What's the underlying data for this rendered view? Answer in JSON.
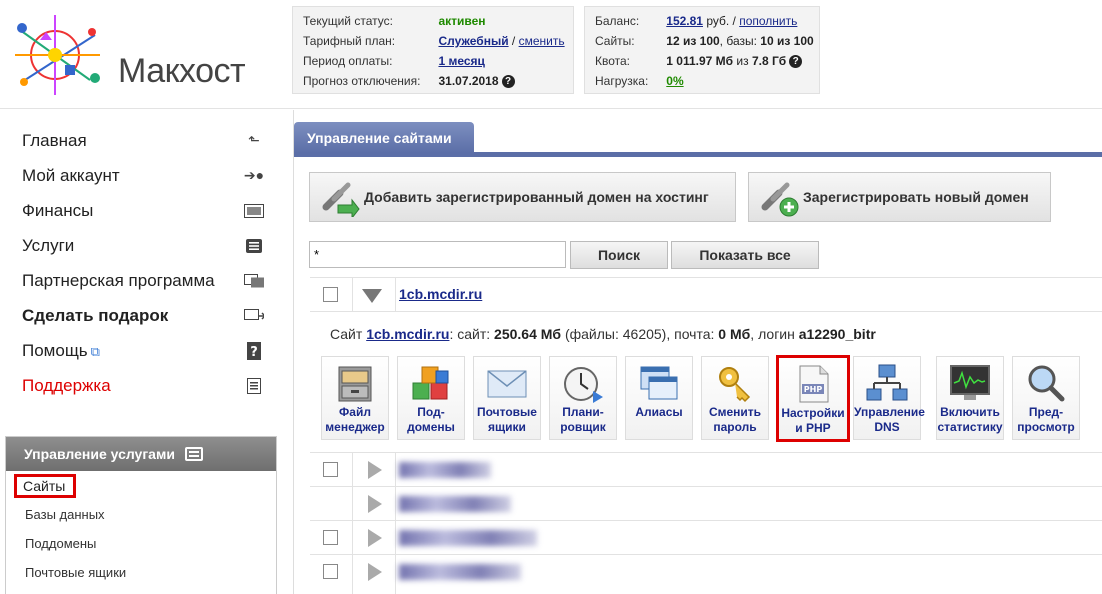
{
  "brand": {
    "name": "Макхост"
  },
  "status": {
    "rows": [
      {
        "key": "Текущий статус:",
        "value": "активен"
      },
      {
        "key": "Тарифный план:",
        "value": "Служебный",
        "sep": " / ",
        "action": "сменить"
      },
      {
        "key": "Период оплаты:",
        "value": "1 месяц"
      },
      {
        "key": "Прогноз отключения:",
        "value": "31.07.2018"
      }
    ]
  },
  "account": {
    "balance_key": "Баланс:",
    "balance_value": "152.81",
    "balance_unit": " руб. / ",
    "balance_action": "пополнить",
    "sites_key": "Сайты:",
    "sites_value": "12 из 100",
    "sites_db_label": ", базы: ",
    "sites_db_value": "10 из 100",
    "quota_key": "Квота:",
    "quota_value": "1 011.97 Мб",
    "quota_mid": " из ",
    "quota_total": "7.8 Гб",
    "load_key": "Нагрузка:",
    "load_value": "0%"
  },
  "nav": [
    {
      "label": "Главная",
      "icon": "corner-arrow-icon"
    },
    {
      "label": "Мой аккаунт",
      "icon": "user-arrow-icon"
    },
    {
      "label": "Финансы",
      "icon": "money-icon"
    },
    {
      "label": "Услуги",
      "icon": "list-icon"
    },
    {
      "label": "Партнерская программа",
      "icon": "partner-icon"
    },
    {
      "label": "Сделать подарок",
      "icon": "gift-icon"
    },
    {
      "label": "Помощь",
      "icon": "help-icon"
    },
    {
      "label": "Поддержка",
      "icon": "support-icon"
    }
  ],
  "service_panel": {
    "title": "Управление услугами",
    "items": [
      "Сайты",
      "Базы данных",
      "Поддомены",
      "Почтовые ящики"
    ]
  },
  "main": {
    "tab": "Управление сайтами",
    "add_domain": "Добавить зарегистрированный домен на хостинг",
    "register_domain": "Зарегистрировать новый домен",
    "search_value": "*",
    "search_button": "Поиск",
    "show_all_button": "Показать все",
    "site": {
      "domain": "1cb.mcdir.ru",
      "info_prefix": "Сайт ",
      "info_mid1": ": сайт: ",
      "site_size": "250.64 Мб",
      "info_mid2": " (файлы: 46205), почта: ",
      "mail_size": "0 Мб",
      "info_mid3": ", логин ",
      "login": "a12290_bitr"
    },
    "tools": [
      {
        "l1": "Файл",
        "l2": "менеджер"
      },
      {
        "l1": "Под-",
        "l2": "домены"
      },
      {
        "l1": "Почтовые",
        "l2": "ящики"
      },
      {
        "l1": "Плани-",
        "l2": "ровщик"
      },
      {
        "l1": "Алиасы",
        "l2": ""
      },
      {
        "l1": "Сменить",
        "l2": "пароль"
      },
      {
        "l1": "Настройки",
        "l2": "и PHP"
      },
      {
        "l1": "Управление",
        "l2": "DNS"
      },
      {
        "l1": "Включить",
        "l2": "статистику"
      },
      {
        "l1": "Пред-",
        "l2": "просмотр"
      }
    ],
    "php_badge": "PHP"
  },
  "colors": {
    "accent": "#5b6ea7",
    "highlight": "#dd0000",
    "link": "#1a2a8a",
    "green": "#1f8a00"
  }
}
